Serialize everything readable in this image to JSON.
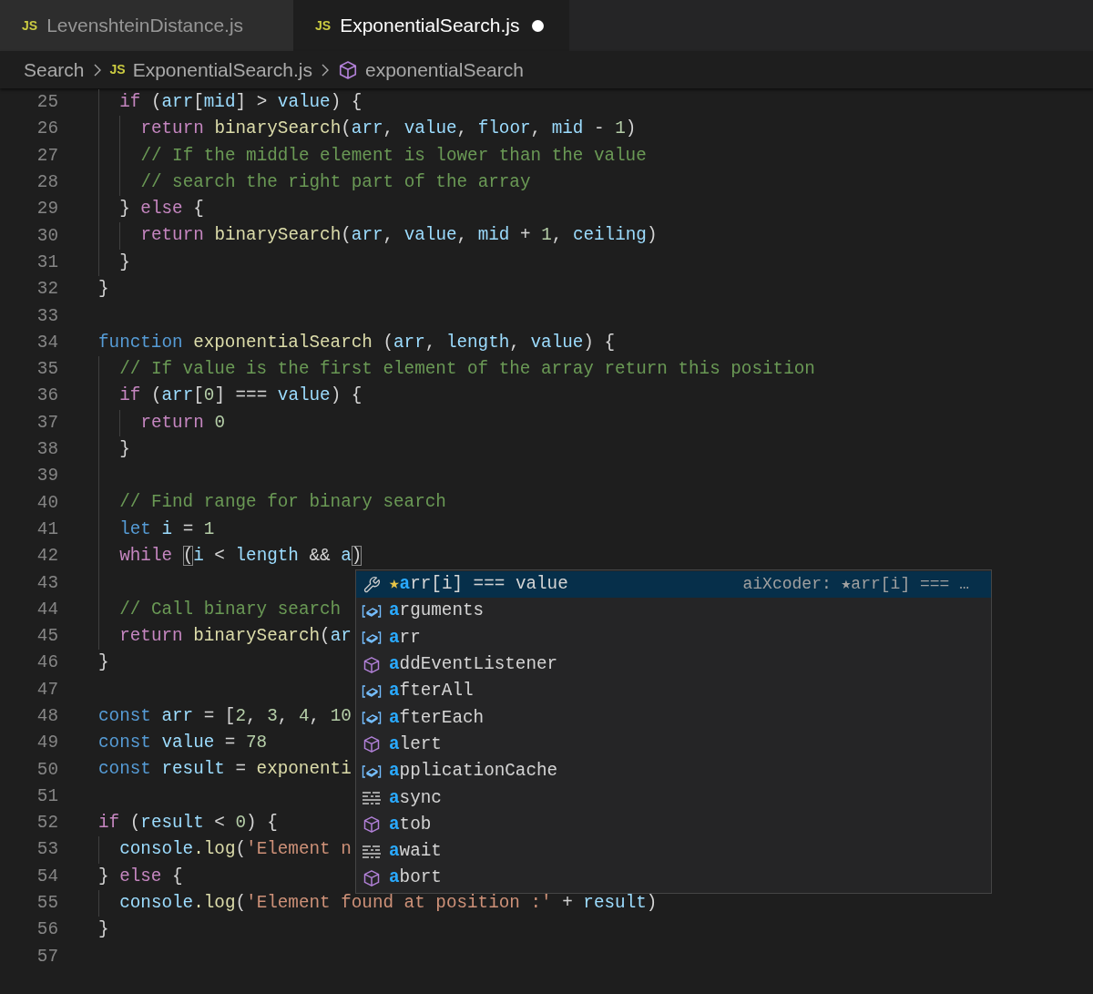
{
  "tabs": [
    {
      "badge": "JS",
      "label": "LevenshteinDistance.js",
      "selected": false,
      "modified": false
    },
    {
      "badge": "JS",
      "label": "ExponentialSearch.js",
      "selected": true,
      "modified": true
    }
  ],
  "breadcrumb": [
    {
      "kind": "folder",
      "label": "Search"
    },
    {
      "kind": "file",
      "badge": "JS",
      "label": "ExponentialSearch.js"
    },
    {
      "kind": "symbol",
      "label": "exponentialSearch"
    }
  ],
  "lines": [
    {
      "number": "25",
      "tokens": [
        {
          "text": "  if",
          "kind": "kw"
        },
        {
          "text": " (",
          "kind": "p"
        },
        {
          "text": "arr",
          "kind": "v"
        },
        {
          "text": "[",
          "kind": "p"
        },
        {
          "text": "mid",
          "kind": "v"
        },
        {
          "text": "] > ",
          "kind": "p"
        },
        {
          "text": "value",
          "kind": "v"
        },
        {
          "text": ") {",
          "kind": "p"
        }
      ]
    },
    {
      "number": "26",
      "tokens": [
        {
          "text": "    return",
          "kind": "kw"
        },
        {
          "text": " binarySearch",
          "kind": "fn"
        },
        {
          "text": "(",
          "kind": "p"
        },
        {
          "text": "arr",
          "kind": "v"
        },
        {
          "text": ", ",
          "kind": "p"
        },
        {
          "text": "value",
          "kind": "v"
        },
        {
          "text": ", ",
          "kind": "p"
        },
        {
          "text": "floor",
          "kind": "v"
        },
        {
          "text": ", ",
          "kind": "p"
        },
        {
          "text": "mid",
          "kind": "v"
        },
        {
          "text": " - ",
          "kind": "p"
        },
        {
          "text": "1",
          "kind": "n"
        },
        {
          "text": ")",
          "kind": "p"
        }
      ]
    },
    {
      "number": "27",
      "tokens": [
        {
          "text": "    // If the middle element is lower than the value",
          "kind": "c"
        }
      ]
    },
    {
      "number": "28",
      "tokens": [
        {
          "text": "    // search the right part of the array",
          "kind": "c"
        }
      ]
    },
    {
      "number": "29",
      "tokens": [
        {
          "text": "  }",
          "kind": "p"
        },
        {
          "text": " else",
          "kind": "kw"
        },
        {
          "text": " {",
          "kind": "p"
        }
      ]
    },
    {
      "number": "30",
      "tokens": [
        {
          "text": "    return",
          "kind": "kw"
        },
        {
          "text": " binarySearch",
          "kind": "fn"
        },
        {
          "text": "(",
          "kind": "p"
        },
        {
          "text": "arr",
          "kind": "v"
        },
        {
          "text": ", ",
          "kind": "p"
        },
        {
          "text": "value",
          "kind": "v"
        },
        {
          "text": ", ",
          "kind": "p"
        },
        {
          "text": "mid",
          "kind": "v"
        },
        {
          "text": " + ",
          "kind": "p"
        },
        {
          "text": "1",
          "kind": "n"
        },
        {
          "text": ", ",
          "kind": "p"
        },
        {
          "text": "ceiling",
          "kind": "v"
        },
        {
          "text": ")",
          "kind": "p"
        }
      ]
    },
    {
      "number": "31",
      "tokens": [
        {
          "text": "  }",
          "kind": "p"
        }
      ]
    },
    {
      "number": "32",
      "tokens": [
        {
          "text": "}",
          "kind": "p"
        }
      ]
    },
    {
      "number": "33"
    },
    {
      "number": "34",
      "tokens": [
        {
          "text": "function",
          "kind": "st"
        },
        {
          "text": " exponentialSearch",
          "kind": "fn"
        },
        {
          "text": " (",
          "kind": "p"
        },
        {
          "text": "arr",
          "kind": "v"
        },
        {
          "text": ", ",
          "kind": "p"
        },
        {
          "text": "length",
          "kind": "v"
        },
        {
          "text": ", ",
          "kind": "p"
        },
        {
          "text": "value",
          "kind": "v"
        },
        {
          "text": ") {",
          "kind": "p"
        }
      ]
    },
    {
      "number": "35",
      "tokens": [
        {
          "text": "  // If value is the first element of the array return this position",
          "kind": "c"
        }
      ]
    },
    {
      "number": "36",
      "tokens": [
        {
          "text": "  if",
          "kind": "kw"
        },
        {
          "text": " (",
          "kind": "p"
        },
        {
          "text": "arr",
          "kind": "v"
        },
        {
          "text": "[",
          "kind": "p"
        },
        {
          "text": "0",
          "kind": "n"
        },
        {
          "text": "] === ",
          "kind": "p"
        },
        {
          "text": "value",
          "kind": "v"
        },
        {
          "text": ") {",
          "kind": "p"
        }
      ]
    },
    {
      "number": "37",
      "tokens": [
        {
          "text": "    return",
          "kind": "kw"
        },
        {
          "text": " 0",
          "kind": "n"
        }
      ]
    },
    {
      "number": "38",
      "tokens": [
        {
          "text": "  }",
          "kind": "p"
        }
      ]
    },
    {
      "number": "39",
      "guide": true
    },
    {
      "number": "40",
      "tokens": [
        {
          "text": "  // Find range for binary search",
          "kind": "c"
        }
      ]
    },
    {
      "number": "41",
      "tokens": [
        {
          "text": "  let",
          "kind": "st"
        },
        {
          "text": " i",
          "kind": "v"
        },
        {
          "text": " = ",
          "kind": "p"
        },
        {
          "text": "1",
          "kind": "n"
        }
      ]
    },
    {
      "number": "42",
      "tokens": [
        {
          "text": "  while ",
          "kind": "kw"
        },
        {
          "text": "(",
          "kind": "bm"
        },
        {
          "text": "i",
          "kind": "v"
        },
        {
          "text": " < ",
          "kind": "p"
        },
        {
          "text": "length",
          "kind": "v"
        },
        {
          "text": " && ",
          "kind": "p"
        },
        {
          "text": "a",
          "kind": "v"
        },
        {
          "text": ")",
          "kind": "bm"
        }
      ]
    },
    {
      "number": "43",
      "guide": true
    },
    {
      "number": "44",
      "tokens": [
        {
          "text": "  // Call binary search",
          "kind": "c"
        }
      ]
    },
    {
      "number": "45",
      "tokens": [
        {
          "text": "  return",
          "kind": "kw"
        },
        {
          "text": " binarySearch",
          "kind": "fn"
        },
        {
          "text": "(",
          "kind": "p"
        },
        {
          "text": "ar",
          "kind": "v"
        }
      ]
    },
    {
      "number": "46",
      "tokens": [
        {
          "text": "}",
          "kind": "p"
        }
      ]
    },
    {
      "number": "47"
    },
    {
      "number": "48",
      "tokens": [
        {
          "text": "const",
          "kind": "st"
        },
        {
          "text": " arr",
          "kind": "v"
        },
        {
          "text": " = [",
          "kind": "p"
        },
        {
          "text": "2",
          "kind": "n"
        },
        {
          "text": ", ",
          "kind": "p"
        },
        {
          "text": "3",
          "kind": "n"
        },
        {
          "text": ", ",
          "kind": "p"
        },
        {
          "text": "4",
          "kind": "n"
        },
        {
          "text": ", ",
          "kind": "p"
        },
        {
          "text": "10",
          "kind": "n"
        }
      ]
    },
    {
      "number": "49",
      "tokens": [
        {
          "text": "const",
          "kind": "st"
        },
        {
          "text": " value",
          "kind": "v"
        },
        {
          "text": " = ",
          "kind": "p"
        },
        {
          "text": "78",
          "kind": "n"
        }
      ]
    },
    {
      "number": "50",
      "tokens": [
        {
          "text": "const",
          "kind": "st"
        },
        {
          "text": " result",
          "kind": "v"
        },
        {
          "text": " = ",
          "kind": "p"
        },
        {
          "text": "exponenti",
          "kind": "fn"
        }
      ]
    },
    {
      "number": "51"
    },
    {
      "number": "52",
      "tokens": [
        {
          "text": "if",
          "kind": "kw"
        },
        {
          "text": " (",
          "kind": "p"
        },
        {
          "text": "result",
          "kind": "v"
        },
        {
          "text": " < ",
          "kind": "p"
        },
        {
          "text": "0",
          "kind": "n"
        },
        {
          "text": ") {",
          "kind": "p"
        }
      ]
    },
    {
      "number": "53",
      "tokens": [
        {
          "text": "  console",
          "kind": "v"
        },
        {
          "text": ".log",
          "kind": "fn"
        },
        {
          "text": "(",
          "kind": "p"
        },
        {
          "text": "'Element n",
          "kind": "s"
        }
      ]
    },
    {
      "number": "54",
      "tokens": [
        {
          "text": "}",
          "kind": "p"
        },
        {
          "text": " else",
          "kind": "kw"
        },
        {
          "text": " {",
          "kind": "p"
        }
      ]
    },
    {
      "number": "55",
      "tokens": [
        {
          "text": "  console",
          "kind": "v"
        },
        {
          "text": ".log",
          "kind": "fn"
        },
        {
          "text": "(",
          "kind": "p"
        },
        {
          "text": "'Element found at position :'",
          "kind": "s"
        },
        {
          "text": " + ",
          "kind": "p"
        },
        {
          "text": "result",
          "kind": "v"
        },
        {
          "text": ")",
          "kind": "p"
        }
      ]
    },
    {
      "number": "56",
      "tokens": [
        {
          "text": "}",
          "kind": "p"
        }
      ]
    },
    {
      "number": "57"
    }
  ],
  "suggestions": [
    {
      "kind": "tool",
      "prefix": "★",
      "match": "a",
      "rest": "rr[i] === value",
      "detail": "aiXcoder: ★arr[i] === …",
      "selected": true
    },
    {
      "kind": "variable",
      "match": "a",
      "rest": "rguments",
      "selected": false
    },
    {
      "kind": "variable",
      "match": "a",
      "rest": "rr",
      "selected": false
    },
    {
      "kind": "method",
      "match": "a",
      "rest": "ddEventListener",
      "selected": false
    },
    {
      "kind": "variable",
      "match": "a",
      "rest": "fterAll",
      "selected": false
    },
    {
      "kind": "variable",
      "match": "a",
      "rest": "fterEach",
      "selected": false
    },
    {
      "kind": "method",
      "match": "a",
      "rest": "lert",
      "selected": false
    },
    {
      "kind": "variable",
      "match": "a",
      "rest": "pplicationCache",
      "selected": false
    },
    {
      "kind": "keyword",
      "match": "a",
      "rest": "sync",
      "selected": false
    },
    {
      "kind": "method",
      "match": "a",
      "rest": "tob",
      "selected": false
    },
    {
      "kind": "keyword",
      "match": "a",
      "rest": "wait",
      "selected": false
    },
    {
      "kind": "method",
      "match": "a",
      "rest": "bort",
      "selected": false
    }
  ]
}
